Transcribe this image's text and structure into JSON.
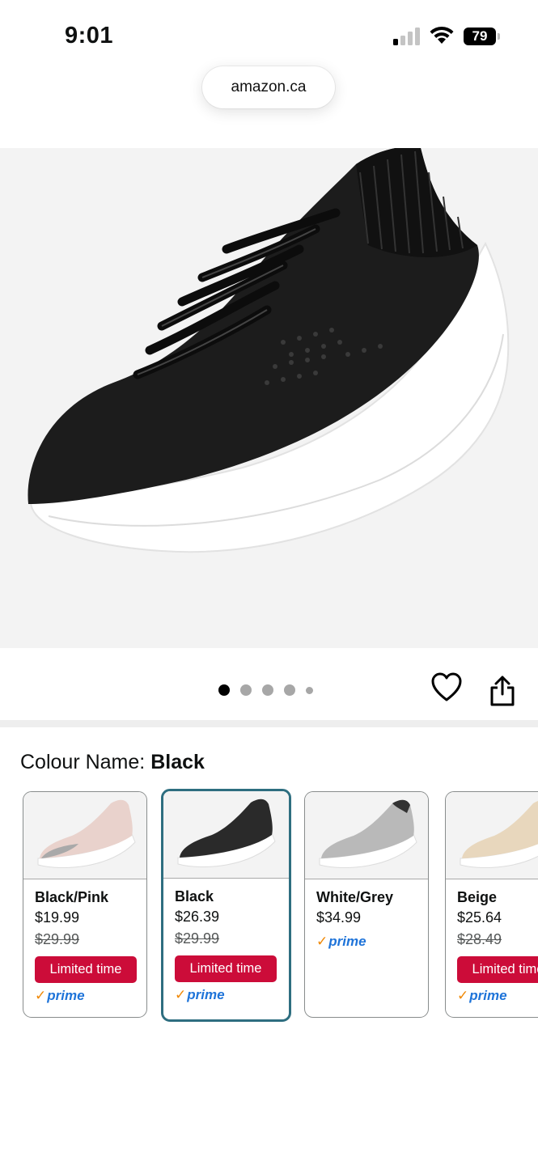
{
  "status_bar": {
    "time": "9:01",
    "battery": "79"
  },
  "browser": {
    "url": "amazon.ca"
  },
  "gallery": {
    "image_count": 5,
    "active_index": 0
  },
  "colour": {
    "label": "Colour Name:",
    "selected": "Black"
  },
  "swatches": [
    {
      "name": "Black/Pink",
      "price": "$19.99",
      "list_price": "$29.99",
      "deal": "Limited time",
      "prime": "prime",
      "shoe_color": "#e9d2cc"
    },
    {
      "name": "Black",
      "price": "$26.39",
      "list_price": "$29.99",
      "deal": "Limited time",
      "prime": "prime",
      "shoe_color": "#2a2a2a"
    },
    {
      "name": "White/Grey",
      "price": "$34.99",
      "list_price": "",
      "deal": "",
      "prime": "prime",
      "shoe_color": "#b9b9b9"
    },
    {
      "name": "Beige",
      "price": "$25.64",
      "list_price": "$28.49",
      "deal": "Limited time",
      "prime": "prime",
      "shoe_color": "#e8d7bd"
    }
  ],
  "colors": {
    "deal_red": "#cc0c39",
    "selected_border": "#2e6e80",
    "prime_blue": "#1f74d9",
    "prime_check": "#f08804"
  },
  "icons": [
    "signal-icon",
    "wifi-icon",
    "battery-icon",
    "heart-icon",
    "share-icon",
    "prime-check-icon"
  ]
}
